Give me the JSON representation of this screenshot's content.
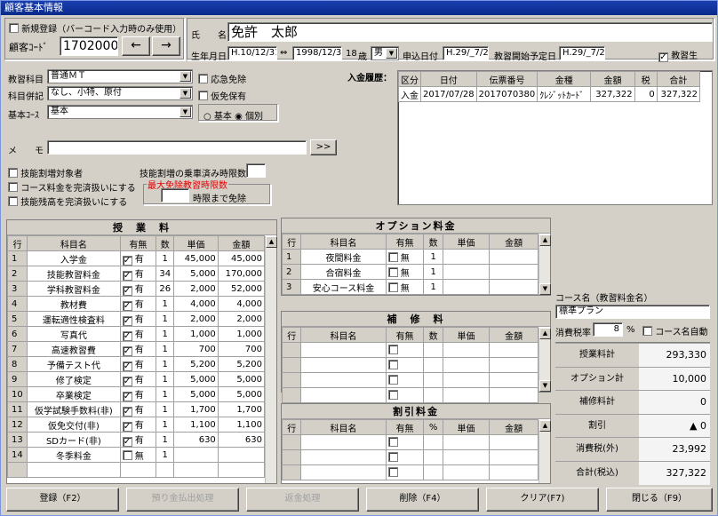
{
  "window": {
    "title": "顧客基本情報"
  },
  "top": {
    "new_reg_label": "新規登録（バーコード入力時のみ使用）",
    "customer_code_label": "顧客ｺｰﾄﾞ",
    "customer_code": "1702000",
    "prev_icon": "←",
    "next_icon": "→",
    "name_label": "氏　　名",
    "name": "免許　太郎",
    "birth_label": "生年月日",
    "birth_wareki": "H.10/12/31",
    "birth_arrow": "⇔",
    "birth_seireki": "1998/12/31",
    "age": "18",
    "age_unit": "歳",
    "gender": "男",
    "apply_label": "申込日付",
    "apply_date": "H.29/_7/22",
    "start_label": "教習開始予定日",
    "start_date": "H.29/_7/25",
    "student_label": "教習生"
  },
  "left": {
    "subject_label": "教習科目",
    "subject": "普通ＭＴ",
    "combo_label": "科目併記",
    "combo": "なし、小特、原付",
    "course_label": "基本ｺｰｽ",
    "course": "基本",
    "urgent_label": "応急免除",
    "temp_label": "仮免保有",
    "radio_basic": "基本",
    "radio_indiv": "個別",
    "memo_label": "メ　　モ",
    "memo_btn": ">>",
    "skill_target": "技能割増対象者",
    "course_fee_done": "コース料金を完済扱いにする",
    "skill_rest_done": "技能残高を完済扱いにする",
    "skill_limit_label": "技能割増の乗車済み時限数",
    "max_exempt_title": "最大免除教習時限数",
    "max_exempt_suffix": "時限まで免除"
  },
  "payment": {
    "title": "入金履歴：",
    "headers": [
      "区分",
      "日付",
      "伝票番号",
      "金種",
      "金額",
      "税",
      "合計"
    ],
    "rows": [
      [
        "入金",
        "2017/07/28",
        "2017070380",
        "ｸﾚｼﾞｯﾄｶｰﾄﾞ",
        "327,322",
        "0",
        "327,322"
      ]
    ]
  },
  "lesson": {
    "title": "授　業　料",
    "headers": [
      "行",
      "科目名",
      "有無",
      "数",
      "単価",
      "金額"
    ],
    "rows": [
      [
        "1",
        "入学金",
        "✓",
        "有",
        "1",
        "45,000",
        "45,000"
      ],
      [
        "2",
        "技能教習料金",
        "✓",
        "有",
        "34",
        "5,000",
        "170,000"
      ],
      [
        "3",
        "学科教習料金",
        "✓",
        "有",
        "26",
        "2,000",
        "52,000"
      ],
      [
        "4",
        "教材費",
        "✓",
        "有",
        "1",
        "4,000",
        "4,000"
      ],
      [
        "5",
        "運転適性検査料",
        "✓",
        "有",
        "1",
        "2,000",
        "2,000"
      ],
      [
        "6",
        "写真代",
        "✓",
        "有",
        "1",
        "1,000",
        "1,000"
      ],
      [
        "7",
        "高速教習費",
        "✓",
        "有",
        "1",
        "700",
        "700"
      ],
      [
        "8",
        "予備テスト代",
        "✓",
        "有",
        "1",
        "5,200",
        "5,200"
      ],
      [
        "9",
        "修了検定",
        "✓",
        "有",
        "1",
        "5,000",
        "5,000"
      ],
      [
        "10",
        "卒業検定",
        "✓",
        "有",
        "1",
        "5,000",
        "5,000"
      ],
      [
        "11",
        "仮学試験手数料(非)",
        "✓",
        "有",
        "1",
        "1,700",
        "1,700"
      ],
      [
        "12",
        "仮免交付(非)",
        "✓",
        "有",
        "1",
        "1,100",
        "1,100"
      ],
      [
        "13",
        "SDカード(非)",
        "✓",
        "有",
        "1",
        "630",
        "630"
      ],
      [
        "14",
        "冬季料金",
        "",
        "無",
        "1",
        "",
        ""
      ]
    ]
  },
  "option": {
    "title": "オプション料金",
    "headers": [
      "行",
      "科目名",
      "有無",
      "数",
      "単価",
      "金額"
    ],
    "rows": [
      [
        "1",
        "夜間料金",
        "",
        "無",
        "1",
        "",
        ""
      ],
      [
        "2",
        "合宿料金",
        "",
        "無",
        "1",
        "",
        ""
      ],
      [
        "3",
        "安心コース料金",
        "",
        "無",
        "1",
        "",
        ""
      ]
    ]
  },
  "supplement": {
    "title": "補　修　料",
    "headers": [
      "行",
      "科目名",
      "有無",
      "数",
      "単価",
      "金額"
    ]
  },
  "discount": {
    "title": "割引料金",
    "headers": [
      "行",
      "科目名",
      "有無",
      "%",
      "単価",
      "金額"
    ]
  },
  "summary": {
    "course_name_label": "コース名（教習料金名）",
    "course_name": "標準プラン",
    "tax_label": "消費税率",
    "tax_rate": "8",
    "tax_unit": "%",
    "auto_label": "コース名自動",
    "rows": [
      {
        "label": "授業料計",
        "value": "293,330"
      },
      {
        "label": "オプション計",
        "value": "10,000"
      },
      {
        "label": "補修料計",
        "value": "0"
      },
      {
        "label": "割引",
        "value": "▲ 0"
      },
      {
        "label": "消費税(外)",
        "value": "23,992"
      },
      {
        "label": "合計(税込)",
        "value": "327,322"
      }
    ]
  },
  "buttons": {
    "register": "登録（F2）",
    "prepaid": "預り金払出処理",
    "refund": "返金処理",
    "delete": "削除（F4）",
    "clear": "クリア(F7)",
    "close": "閉じる（F9）"
  }
}
